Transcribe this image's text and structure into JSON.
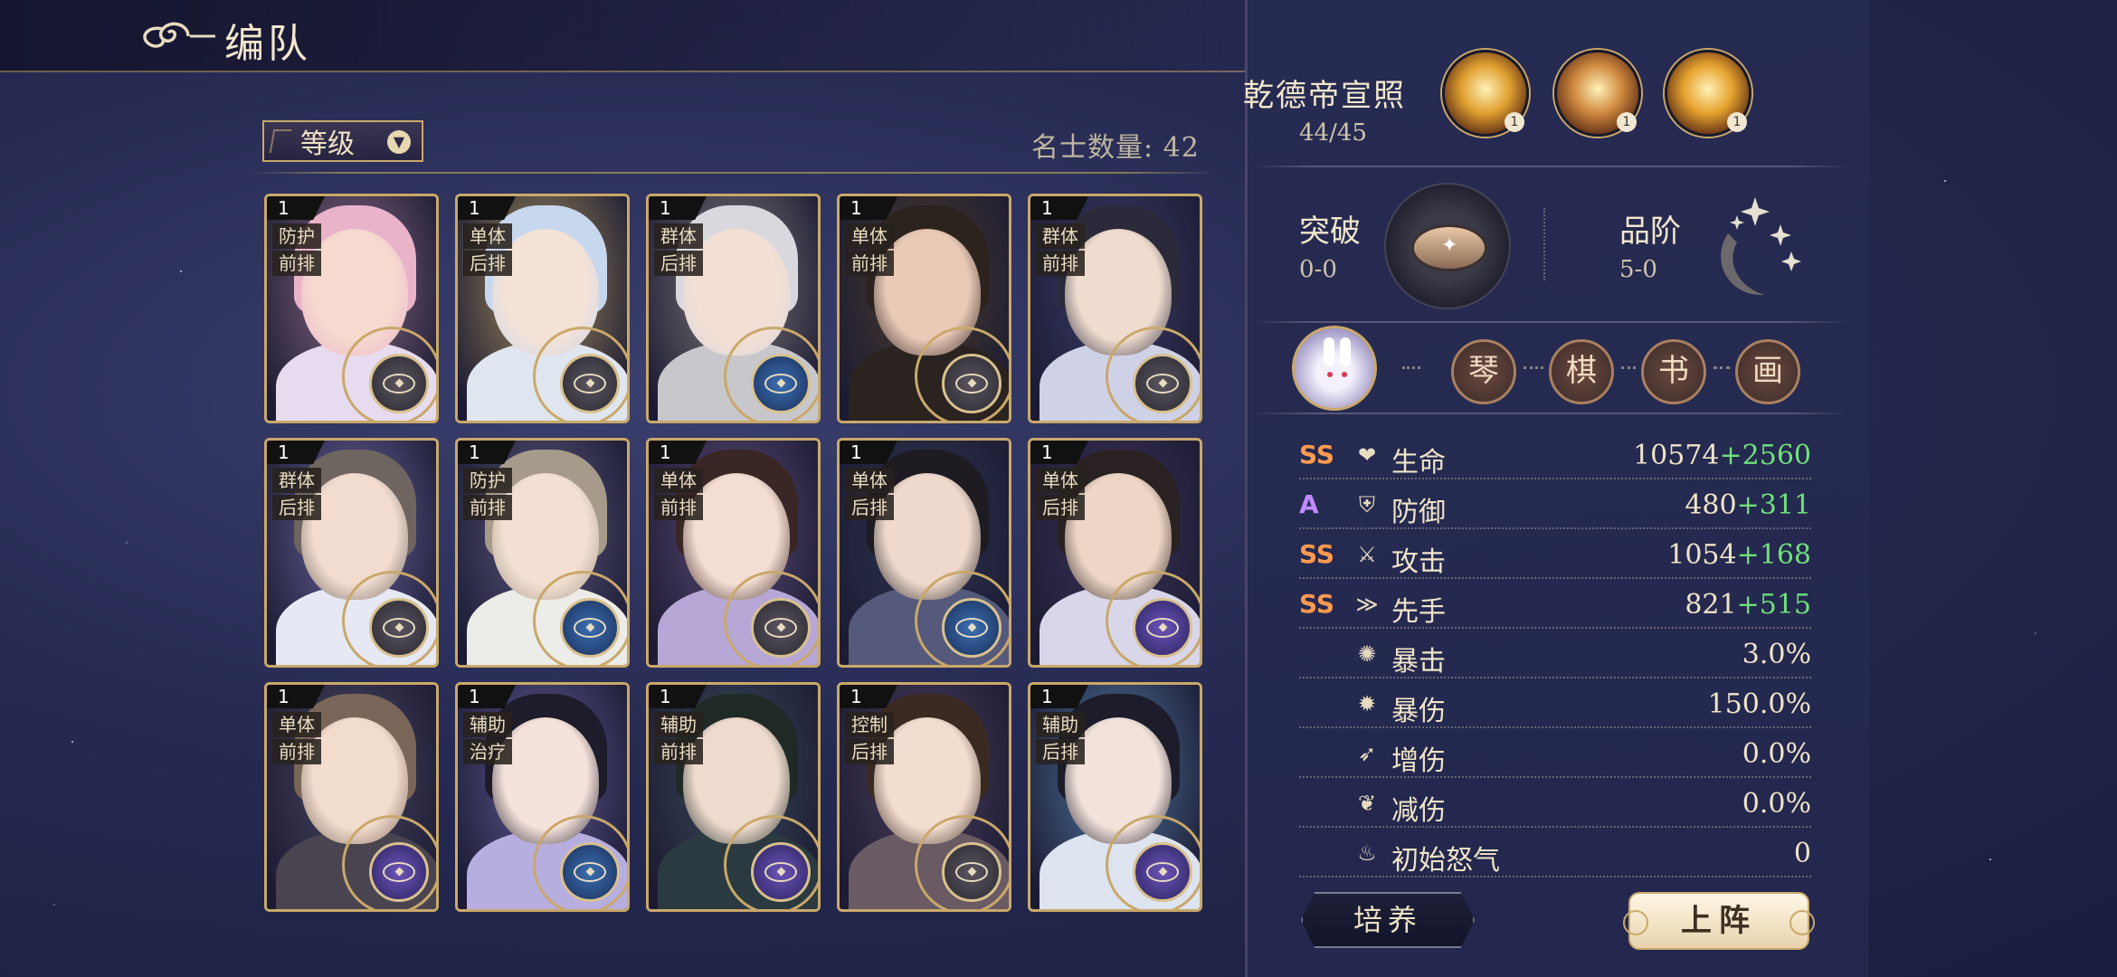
{
  "header": {
    "title": "编队"
  },
  "toolbar": {
    "sort_label": "等级",
    "count_text": "名士数量: 42"
  },
  "cards": [
    {
      "level": "1",
      "role": "防护",
      "position": "前排",
      "badge": "gray",
      "hair": "#e9b3c9",
      "skin": "#f6d9cf",
      "bg": "#8a6a86",
      "body": "#e7dcef"
    },
    {
      "level": "1",
      "role": "单体",
      "position": "后排",
      "badge": "gray",
      "hair": "#c7d7ee",
      "skin": "#f5e2d6",
      "bg": "#a48f5d",
      "body": "#dfe6ef"
    },
    {
      "level": "1",
      "role": "群体",
      "position": "后排",
      "badge": "blue",
      "hair": "#d8d8de",
      "skin": "#f3dfd3",
      "bg": "#7f7a7a",
      "body": "#c8c8cc"
    },
    {
      "level": "1",
      "role": "单体",
      "position": "前排",
      "badge": "gray",
      "hair": "#2c221e",
      "skin": "#eac9b6",
      "bg": "#4a3c2c",
      "body": "#2a2320"
    },
    {
      "level": "1",
      "role": "群体",
      "position": "前排",
      "badge": "gray",
      "hair": "#2a2a3a",
      "skin": "#f0dccf",
      "bg": "#3b3e6a",
      "body": "#cfd2e6"
    },
    {
      "level": "1",
      "role": "群体",
      "position": "后排",
      "badge": "gray",
      "hair": "#6e6560",
      "skin": "#f2dcd0",
      "bg": "#6a66a0",
      "body": "#e6e8f4"
    },
    {
      "level": "1",
      "role": "防护",
      "position": "前排",
      "badge": "blue",
      "hair": "#a69a8a",
      "skin": "#f3e0d2",
      "bg": "#5a587e",
      "body": "#ecece8"
    },
    {
      "level": "1",
      "role": "单体",
      "position": "前排",
      "badge": "gray",
      "hair": "#3a2624",
      "skin": "#f4ddd2",
      "bg": "#5d4b78",
      "body": "#b7a7d6"
    },
    {
      "level": "1",
      "role": "单体",
      "position": "后排",
      "badge": "blue",
      "hair": "#1e1c22",
      "skin": "#efd9cc",
      "bg": "#2e3550",
      "body": "#555a7c"
    },
    {
      "level": "1",
      "role": "单体",
      "position": "后排",
      "badge": "purple",
      "hair": "#2a2222",
      "skin": "#eed6c6",
      "bg": "#3b3358",
      "body": "#d9d6ea"
    },
    {
      "level": "1",
      "role": "单体",
      "position": "前排",
      "badge": "purple",
      "hair": "#7a6658",
      "skin": "#f2dcce",
      "bg": "#4a4862",
      "body": "#4a4450"
    },
    {
      "level": "1",
      "role": "辅助",
      "position": "治疗",
      "badge": "blue",
      "hair": "#1e1c2a",
      "skin": "#f5e2da",
      "bg": "#5f5a96",
      "body": "#b7aee0"
    },
    {
      "level": "1",
      "role": "辅助",
      "position": "前排",
      "badge": "purple",
      "hair": "#1f2a26",
      "skin": "#efdbcd",
      "bg": "#3a4a5a",
      "body": "#2a3a40"
    },
    {
      "level": "1",
      "role": "控制",
      "position": "后排",
      "badge": "gray",
      "hair": "#3a2a22",
      "skin": "#f3ddcf",
      "bg": "#4b3e5a",
      "body": "#6a5a64"
    },
    {
      "level": "1",
      "role": "辅助",
      "position": "后排",
      "badge": "purple",
      "hair": "#1c1c2a",
      "skin": "#f2e2da",
      "bg": "#4f77a0",
      "body": "#dde4f0"
    }
  ],
  "edict": {
    "title": "乾德帝宣照",
    "count": "44/45",
    "skills": [
      {
        "level": "1",
        "color": "#e0a030"
      },
      {
        "level": "1",
        "color": "#d08a40"
      },
      {
        "level": "1",
        "color": "#e6a32e"
      }
    ]
  },
  "breakthrough": {
    "label": "突破",
    "value": "0-0"
  },
  "rank": {
    "label": "品阶",
    "value": "5-0"
  },
  "arts": [
    "琴",
    "棋",
    "书",
    "画"
  ],
  "stats": [
    {
      "grade": "SS",
      "icon": "❤",
      "name": "生命",
      "base": "10574",
      "bonus": "+2560"
    },
    {
      "grade": "A",
      "icon": "⛨",
      "name": "防御",
      "base": "480",
      "bonus": "+311"
    },
    {
      "grade": "SS",
      "icon": "⚔",
      "name": "攻击",
      "base": "1054",
      "bonus": "+168"
    },
    {
      "grade": "SS",
      "icon": "≫",
      "name": "先手",
      "base": "821",
      "bonus": "+515"
    },
    {
      "grade": "",
      "icon": "✺",
      "name": "暴击",
      "base": "3.0%",
      "bonus": ""
    },
    {
      "grade": "",
      "icon": "✹",
      "name": "暴伤",
      "base": "150.0%",
      "bonus": ""
    },
    {
      "grade": "",
      "icon": "➶",
      "name": "增伤",
      "base": "0.0%",
      "bonus": ""
    },
    {
      "grade": "",
      "icon": "❦",
      "name": "减伤",
      "base": "0.0%",
      "bonus": ""
    },
    {
      "grade": "",
      "icon": "♨",
      "name": "初始怒气",
      "base": "0",
      "bonus": ""
    }
  ],
  "buttons": {
    "train": "培养",
    "deploy": "上阵"
  }
}
